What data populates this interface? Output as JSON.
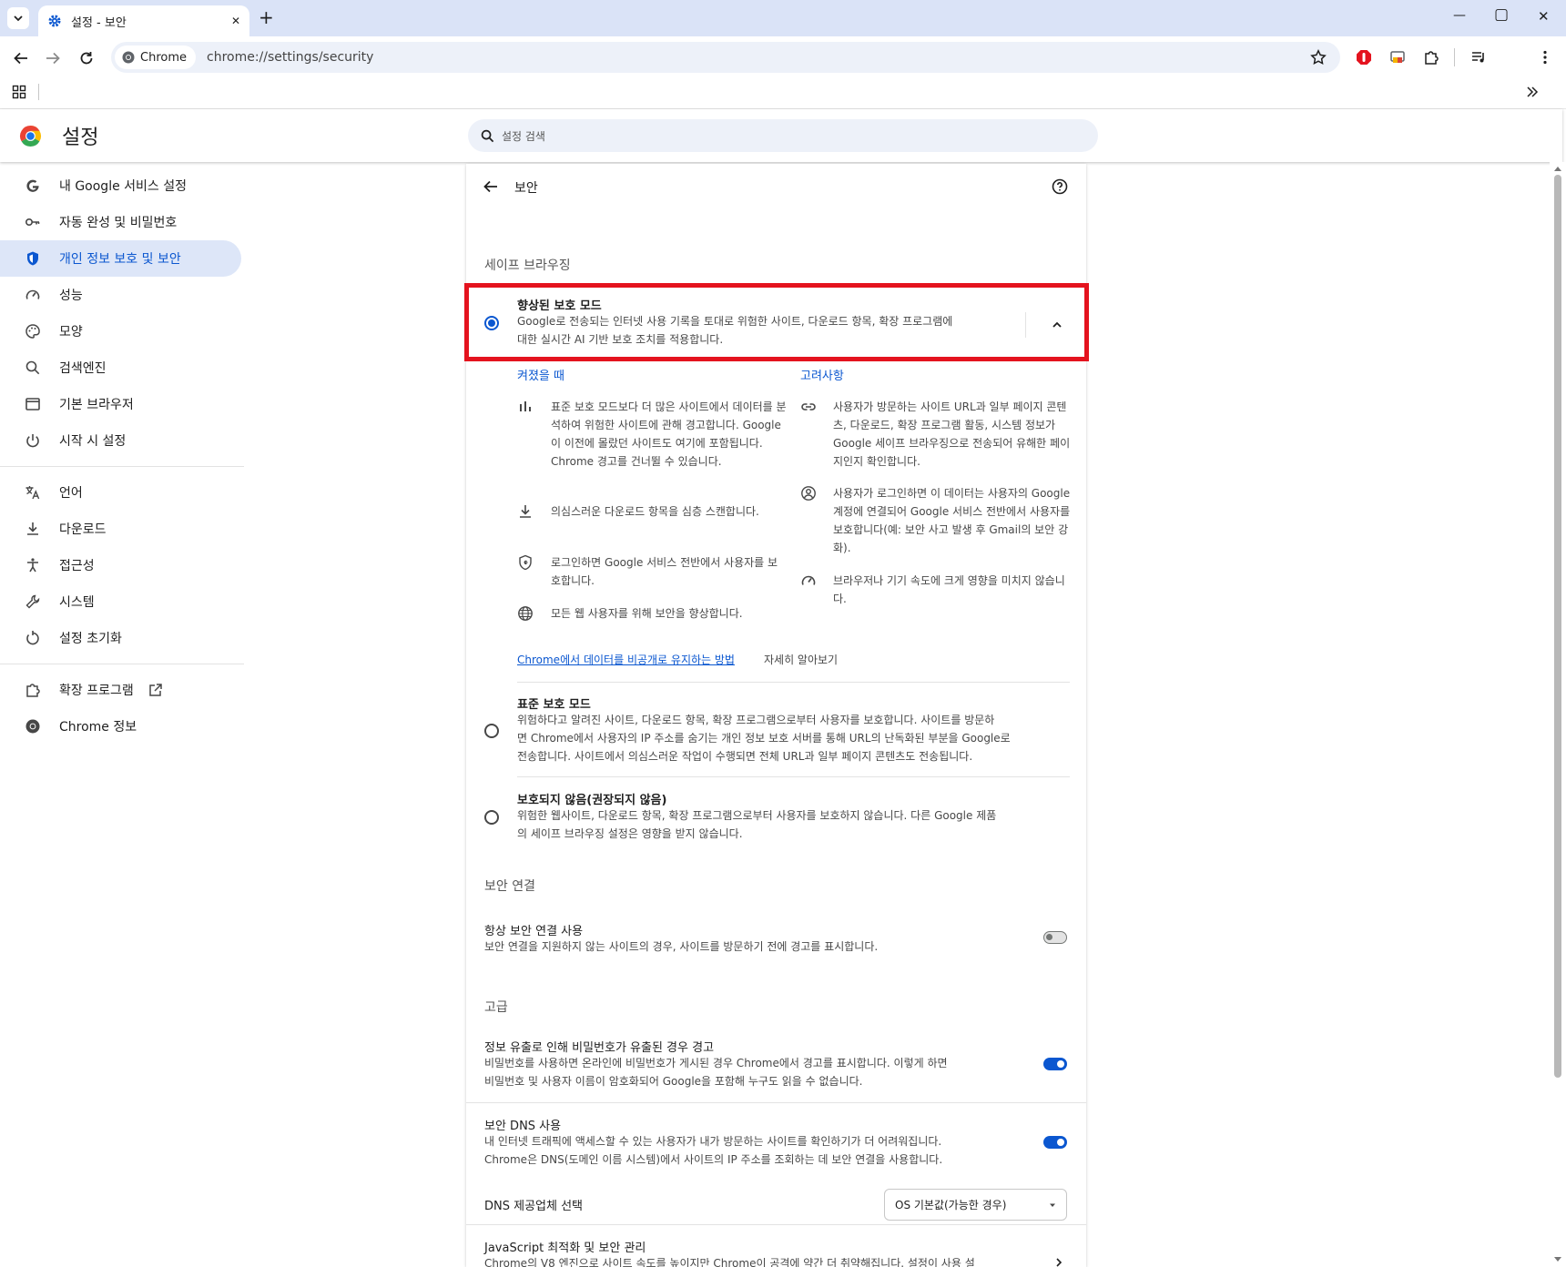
{
  "tab": {
    "title": "설정 - 보안",
    "close": "✕",
    "new_tab": "+"
  },
  "window": {
    "minimize": "—",
    "maximize": "▢",
    "close": "✕"
  },
  "omnibox": {
    "chip_label": "Chrome",
    "url": "chrome://settings/security"
  },
  "settings_header": {
    "title": "설정",
    "search_placeholder": "설정 검색"
  },
  "sidebar": {
    "items": [
      {
        "label": "내 Google 서비스 설정",
        "icon": "google-g-icon"
      },
      {
        "label": "자동 완성 및 비밀번호",
        "icon": "key-icon"
      },
      {
        "label": "개인 정보 보호 및 보안",
        "icon": "shield-icon",
        "active": true
      },
      {
        "label": "성능",
        "icon": "speedometer-icon"
      },
      {
        "label": "모양",
        "icon": "palette-icon"
      },
      {
        "label": "검색엔진",
        "icon": "search-icon"
      },
      {
        "label": "기본 브라우저",
        "icon": "browser-window-icon"
      },
      {
        "label": "시작 시 설정",
        "icon": "power-icon"
      },
      {
        "label": "언어",
        "icon": "translate-icon"
      },
      {
        "label": "다운로드",
        "icon": "download-icon"
      },
      {
        "label": "접근성",
        "icon": "accessibility-icon"
      },
      {
        "label": "시스템",
        "icon": "wrench-icon"
      },
      {
        "label": "설정 초기화",
        "icon": "reset-icon"
      },
      {
        "label": "확장 프로그램",
        "icon": "extension-icon"
      },
      {
        "label": "Chrome 정보",
        "icon": "chrome-icon"
      }
    ]
  },
  "page": {
    "title": "보안",
    "safe_browsing": {
      "heading": "세이프 브라우징",
      "enhanced": {
        "title": "향상된 보호 모드",
        "desc_line1": "Google로 전송되는 인터넷 사용 기록을 토대로 위험한 사이트, 다운로드 항목, 확장 프로그램에",
        "desc_line2": "대한 실시간 AI 기반 보호 조치를 적용합니다.",
        "selected": true,
        "when_on_heading": "켜졌을 때",
        "considerations_heading": "고려사항",
        "when_on": [
          "표준 보호 모드보다 더 많은 사이트에서 데이터를 분석하여 위험한 사이트에 관해 경고합니다. Google이 이전에 몰랐던 사이트도 여기에 포함됩니다. Chrome 경고를 건너뛸 수 있습니다.",
          "의심스러운 다운로드 항목을 심층 스캔합니다.",
          "로그인하면 Google 서비스 전반에서 사용자를 보호합니다.",
          "모든 웹 사용자를 위해 보안을 향상합니다."
        ],
        "considerations": [
          "사용자가 방문하는 사이트 URL과 일부 페이지 콘텐츠, 다운로드, 확장 프로그램 활동, 시스템 정보가 Google 세이프 브라우징으로 전송되어 유해한 페이지인지 확인합니다.",
          "사용자가 로그인하면 이 데이터는 사용자의 Google 계정에 연결되어 Google 서비스 전반에서 사용자를 보호합니다(예: 보안 사고 발생 후 Gmail의 보안 강화).",
          "브라우저나 기기 속도에 크게 영향을 미치지 않습니다."
        ],
        "privacy_link": "Chrome에서 데이터를 비공개로 유지하는 방법",
        "learn_more": "자세히 알아보기"
      },
      "standard": {
        "title": "표준 보호 모드",
        "line1": "위험하다고 알려진 사이트, 다운로드 항목, 확장 프로그램으로부터 사용자를 보호합니다. 사이트를 방문하",
        "line2": "면 Chrome에서 사용자의 IP 주소를 숨기는 개인 정보 보호 서버를 통해 URL의 난독화된 부분을 Google로",
        "line3": "전송합니다. 사이트에서 의심스러운 작업이 수행되면 전체 URL과 일부 페이지 콘텐츠도 전송됩니다."
      },
      "none": {
        "title": "보호되지 않음(권장되지 않음)",
        "line1": "위험한 웹사이트, 다운로드 항목, 확장 프로그램으로부터 사용자를 보호하지 않습니다. 다른 Google 제품",
        "line2": "의 세이프 브라우징 설정은 영향을 받지 않습니다."
      }
    },
    "secure_connections": {
      "heading": "보안 연결",
      "https": {
        "title": "항상 보안 연결 사용",
        "desc": "보안 연결을 지원하지 않는 사이트의 경우, 사이트를 방문하기 전에 경고를 표시합니다.",
        "enabled": false
      }
    },
    "advanced": {
      "heading": "고급",
      "password_leak": {
        "title": "정보 유출로 인해 비밀번호가 유출된 경우 경고",
        "line1": "비밀번호를 사용하면 온라인에 비밀번호가 게시된 경우 Chrome에서 경고를 표시합니다. 이렇게 하면",
        "line2": "비밀번호 및 사용자 이름이 암호화되어 Google을 포함해 누구도 읽을 수 없습니다.",
        "enabled": true
      },
      "secure_dns": {
        "title": "보안 DNS 사용",
        "line1": "내 인터넷 트래픽에 액세스할 수 있는 사용자가 내가 방문하는 사이트를 확인하기가 더 어려워집니다.",
        "line2": "Chrome은 DNS(도메인 이름 시스템)에서 사이트의 IP 주소를 조회하는 데 보안 연결을 사용합니다.",
        "enabled": true
      },
      "dns_provider": {
        "label": "DNS 제공업체 선택",
        "value": "OS 기본값(가능한 경우)"
      },
      "javascript": {
        "title": "JavaScript 최적화 및 보안 관리",
        "desc": "Chrome의 V8 엔진으로 사이트 속도를 높이지만 Chrome이 공격에 약간 더 취약해집니다. 설정이 사용 설"
      }
    }
  },
  "colors": {
    "accent": "#0b57d0",
    "highlight_box": "#e4131e",
    "titlebar": "#dae3f7"
  }
}
